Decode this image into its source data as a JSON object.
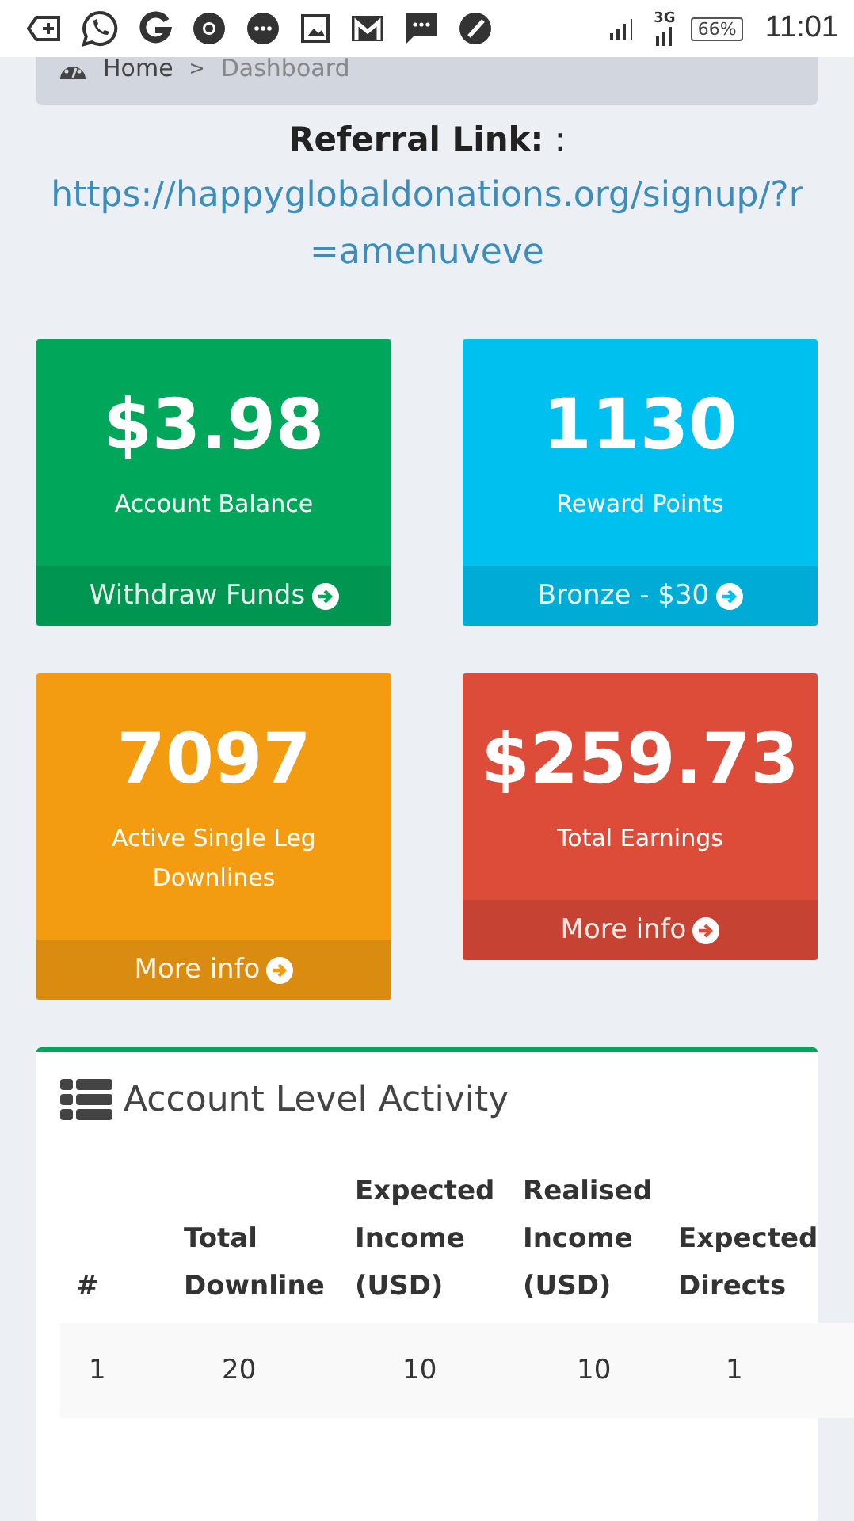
{
  "status_bar": {
    "network": "3G",
    "battery": "66%",
    "time": "11:01"
  },
  "breadcrumb": [
    {
      "label": "Home",
      "selected": false
    },
    {
      "label": "Dashboard",
      "selected": true
    }
  ],
  "breadcrumb_separator": ">",
  "referral": {
    "label": "**Referral Link:** :",
    "link": "https://happyglobaldonations.org/signup/?r=amenuveve"
  },
  "stat_boxes": [
    {
      "value": "$3.98",
      "label": "Account Balance",
      "footer": "Withdraw Funds",
      "color": "#00a65a"
    },
    {
      "value": "1130",
      "label": "Reward Points",
      "footer": "Bronze - $30",
      "color": "#00c0ef"
    },
    {
      "value": "7097",
      "label": "Active Single Leg Downlines",
      "footer": "More info",
      "color": "#f39c12"
    },
    {
      "value": "$259.73",
      "label": "Total Earnings",
      "footer": "More info",
      "color": "#dd4b39"
    }
  ],
  "activity": {
    "title": "Account Level Activity",
    "columns": [
      "#",
      "Total Downline",
      "Expected Income (USD)",
      "Realised Income (USD)",
      "Expected Directs"
    ],
    "rows": [
      [
        "1",
        "20",
        "10",
        "10",
        "1"
      ]
    ]
  }
}
